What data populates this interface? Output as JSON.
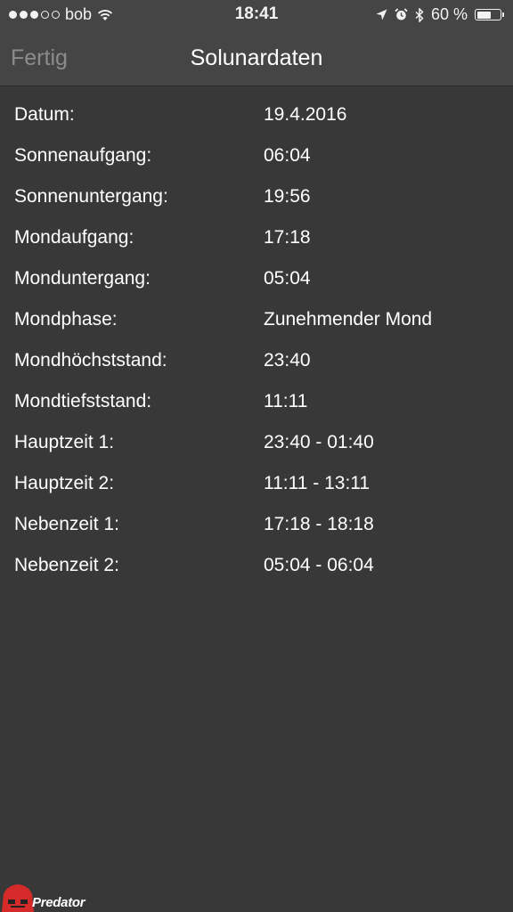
{
  "status_bar": {
    "carrier": "bob",
    "time": "18:41",
    "battery": "60 %",
    "battery_level": 0.6
  },
  "nav": {
    "done_label": "Fertig",
    "title": "Solunardaten"
  },
  "rows": [
    {
      "label": "Datum:",
      "value": "19.4.2016"
    },
    {
      "label": "Sonnenaufgang:",
      "value": "06:04"
    },
    {
      "label": "Sonnenuntergang:",
      "value": "19:56"
    },
    {
      "label": "Mondaufgang:",
      "value": "17:18"
    },
    {
      "label": "Monduntergang:",
      "value": "05:04"
    },
    {
      "label": "Mondphase:",
      "value": "Zunehmender Mond"
    },
    {
      "label": "Mondhöchststand:",
      "value": "23:40"
    },
    {
      "label": "Mondtiefststand:",
      "value": "11:11"
    },
    {
      "label": "Hauptzeit 1:",
      "value": "23:40 - 01:40"
    },
    {
      "label": "Hauptzeit 2:",
      "value": "11:11 - 13:11"
    },
    {
      "label": "Nebenzeit 1:",
      "value": "17:18 - 18:18"
    },
    {
      "label": "Nebenzeit 2:",
      "value": "05:04 - 06:04"
    }
  ],
  "logo": {
    "text": "Predator"
  },
  "colors": {
    "background": "#383838",
    "nav_background": "#454545",
    "done_button": "#8c8c8c",
    "logo_red": "#d42a2a"
  }
}
